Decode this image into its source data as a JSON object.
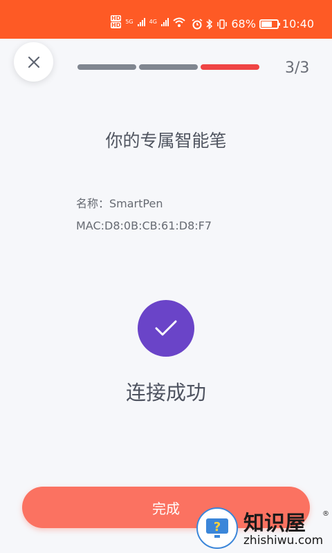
{
  "status_bar": {
    "hd1": "HD",
    "hd2": "HD",
    "network1": "5G",
    "network2": "4G",
    "battery_percent": "68%",
    "time": "10:40",
    "battery_level": 0.68
  },
  "header": {
    "step_count": "3/3",
    "progress": {
      "total_steps": 3,
      "current_step": 3
    }
  },
  "main": {
    "title": "你的专属智能笔",
    "name_line": "名称：SmartPen",
    "mac_line": "MAC:D8:0B:CB:61:D8:F7",
    "success_text": "连接成功"
  },
  "footer": {
    "done_label": "完成"
  },
  "watermark": {
    "brand": "知识屋",
    "registered": "®",
    "domain": "zhishiwu.com"
  },
  "colors": {
    "status_bar_bg": "#fe5a25",
    "progress_done": "#808690",
    "progress_active": "#ef4444",
    "success_circle": "#6a44c8",
    "done_button": "#fb7261"
  },
  "icons": [
    "close-icon",
    "check-icon",
    "wifi-icon",
    "alarm-icon",
    "bluetooth-icon",
    "vibrate-icon",
    "battery-icon"
  ]
}
